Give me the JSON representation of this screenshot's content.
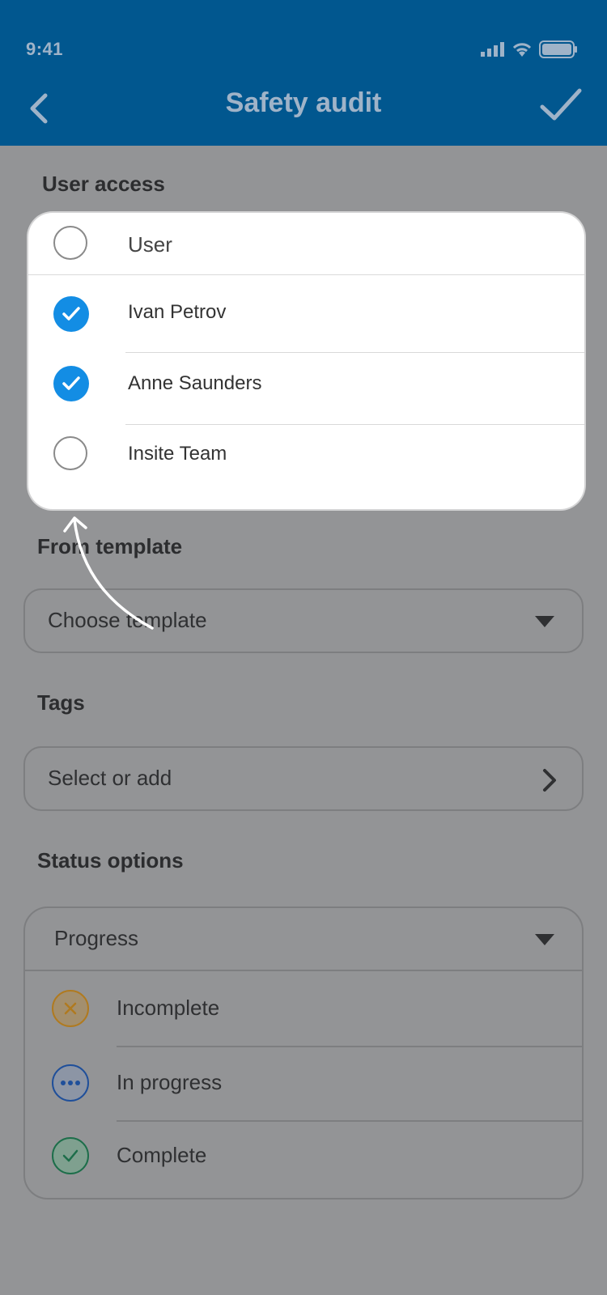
{
  "status_bar": {
    "time": "9:41"
  },
  "nav": {
    "title": "Safety audit"
  },
  "user_access": {
    "section_label": "User access",
    "header_label": "User",
    "options": [
      {
        "label": "Ivan Petrov",
        "checked": true
      },
      {
        "label": "Anne Saunders",
        "checked": true
      },
      {
        "label": "Insite Team",
        "checked": false
      }
    ]
  },
  "template": {
    "section_label": "From template",
    "placeholder": "Choose template"
  },
  "tags": {
    "section_label": "Tags",
    "placeholder": "Select or add"
  },
  "status_options": {
    "section_label": "Status options",
    "selected": "Progress",
    "items": [
      {
        "label": "Incomplete",
        "icon": "cross-icon",
        "color": "#b07a1f"
      },
      {
        "label": "In progress",
        "icon": "ellipsis-icon",
        "color": "#1f4f9a"
      },
      {
        "label": "Complete",
        "icon": "check-icon",
        "color": "#1d6e4a"
      }
    ]
  },
  "colors": {
    "header": "#01578f",
    "accent": "#138de4",
    "overlay": "#939496"
  }
}
